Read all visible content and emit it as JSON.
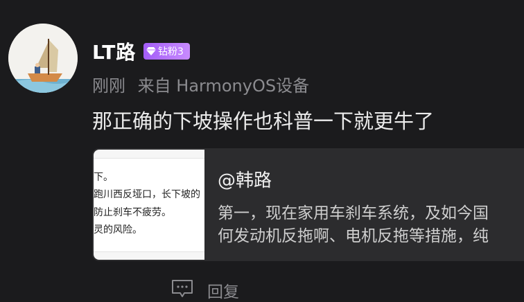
{
  "post": {
    "username": "LT路",
    "badge": "钻粉3",
    "time": "刚刚",
    "source": "来自 HarmonyOS设备",
    "content": "那正确的下坡操作也科普一下就更牛了"
  },
  "quote": {
    "author": "@韩路",
    "lines": [
      "第一，现在家用车刹车系统，及如今国",
      "何发动机反拖啊、电机反拖等措施，纯"
    ],
    "thumbnail_lines": [
      "下。",
      "跑川西反垭口，长下坡的",
      "防止刹车不疲劳。",
      "灵的风险。"
    ]
  },
  "actions": {
    "reply_label": "回复"
  },
  "colors": {
    "badge_start": "#a35df7",
    "badge_end": "#c88bff",
    "background": "#1b1b1d",
    "card": "#2c2c2e"
  },
  "icons": {
    "badge": "diamond-icon",
    "reply": "comment-icon"
  }
}
